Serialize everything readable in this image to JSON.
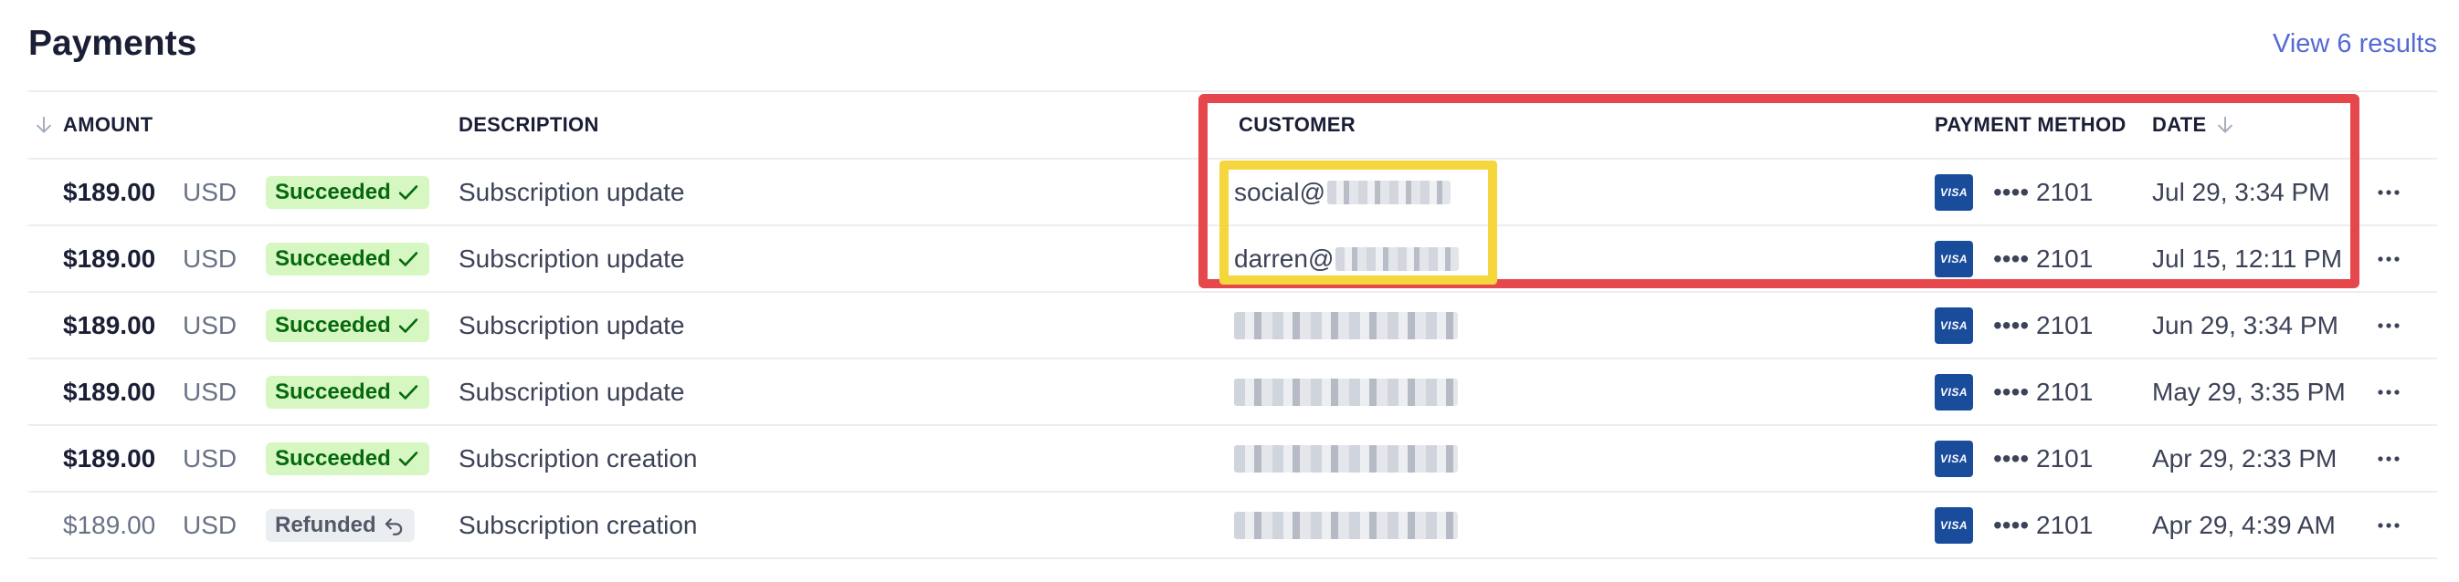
{
  "header": {
    "title": "Payments",
    "view_link": "View 6 results"
  },
  "columns": {
    "amount": "AMOUNT",
    "description": "DESCRIPTION",
    "customer": "CUSTOMER",
    "payment_method": "PAYMENT METHOD",
    "date": "DATE"
  },
  "rows": [
    {
      "amount": "$189.00",
      "currency": "USD",
      "status": "Succeeded",
      "description": "Subscription update",
      "customer": "social@",
      "card_brand": "VISA",
      "card_last4": "•••• 2101",
      "date": "Jul 29, 3:34 PM"
    },
    {
      "amount": "$189.00",
      "currency": "USD",
      "status": "Succeeded",
      "description": "Subscription update",
      "customer": "darren@",
      "card_brand": "VISA",
      "card_last4": "•••• 2101",
      "date": "Jul 15, 12:11 PM"
    },
    {
      "amount": "$189.00",
      "currency": "USD",
      "status": "Succeeded",
      "description": "Subscription update",
      "customer": "",
      "card_brand": "VISA",
      "card_last4": "•••• 2101",
      "date": "Jun 29, 3:34 PM"
    },
    {
      "amount": "$189.00",
      "currency": "USD",
      "status": "Succeeded",
      "description": "Subscription update",
      "customer": "",
      "card_brand": "VISA",
      "card_last4": "•••• 2101",
      "date": "May 29, 3:35 PM"
    },
    {
      "amount": "$189.00",
      "currency": "USD",
      "status": "Succeeded",
      "description": "Subscription creation",
      "customer": "",
      "card_brand": "VISA",
      "card_last4": "•••• 2101",
      "date": "Apr 29, 2:33 PM"
    },
    {
      "amount": "$189.00",
      "currency": "USD",
      "status": "Refunded",
      "description": "Subscription creation",
      "customer": "",
      "card_brand": "VISA",
      "card_last4": "•••• 2101",
      "date": "Apr 29, 4:39 AM"
    }
  ],
  "colors": {
    "accent": "#5469d4",
    "success_bg": "#d7f7c2",
    "success_text": "#05690d",
    "refunded_bg": "#ebeef1",
    "highlight_red": "#e5474d",
    "highlight_yellow": "#f6d63d",
    "visa_blue": "#1a4c9c"
  },
  "icons": {
    "sort": "arrow-down-icon",
    "succeeded": "check-icon",
    "refunded": "undo-arrow-icon",
    "row_menu": "more-horizontal-icon",
    "card": "visa-card-icon"
  }
}
